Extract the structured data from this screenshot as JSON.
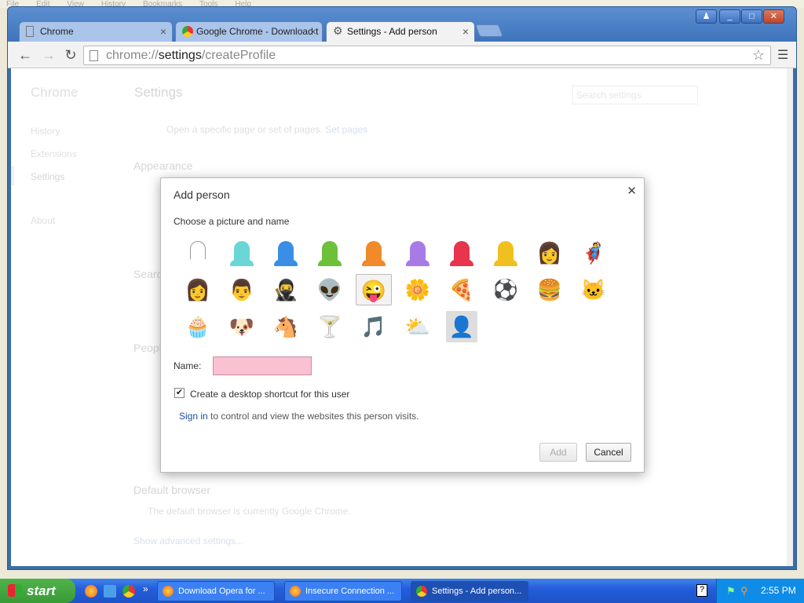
{
  "bg_menubar": [
    "File",
    "Edit",
    "View",
    "History",
    "Bookmarks",
    "Tools",
    "Help"
  ],
  "tabs": [
    {
      "label": "Chrome"
    },
    {
      "label": "Google Chrome - Download t"
    },
    {
      "label": "Settings - Add person"
    }
  ],
  "omnibox": {
    "scheme": "chrome://",
    "host": "settings",
    "path": "/createProfile"
  },
  "page": {
    "sidebar_title": "Chrome",
    "sidebar_items": [
      "History",
      "Extensions",
      "Settings",
      "About"
    ],
    "title": "Settings",
    "search_placeholder": "Search settings",
    "open_specific": "Open a specific page or set of pages.",
    "set_pages": "Set pages",
    "appearance": "Appearance",
    "search": "Searc",
    "people": "People",
    "default_browser": "Default browser",
    "default_browser_text": "The default browser is currently Google Chrome.",
    "show_advanced": "Show advanced settings..."
  },
  "dialog": {
    "title": "Add person",
    "subtitle": "Choose a picture and name",
    "name_label": "Name:",
    "name_value": "",
    "shortcut_label": "Create a desktop shortcut for this user",
    "shortcut_checked": true,
    "signin_link": "Sign in",
    "signin_rest": " to control and view the websites this person visits.",
    "add_label": "Add",
    "cancel_label": "Cancel",
    "avatars": [
      {
        "name": "white-head",
        "color": "#ffffff"
      },
      {
        "name": "cyan-head",
        "color": "#6ad6d6"
      },
      {
        "name": "blue-head",
        "color": "#3a8ee6"
      },
      {
        "name": "green-head",
        "color": "#6cc03a"
      },
      {
        "name": "orange-head",
        "color": "#f08a2a"
      },
      {
        "name": "purple-head",
        "color": "#a87ae6"
      },
      {
        "name": "red-head",
        "color": "#e8344c"
      },
      {
        "name": "yellow-head",
        "color": "#f0c020"
      },
      {
        "name": "businesswoman",
        "glyph": "👩"
      },
      {
        "name": "ninja-hero",
        "glyph": "🦸"
      },
      {
        "name": "woman-sunglasses",
        "glyph": "👩"
      },
      {
        "name": "man",
        "glyph": "👨"
      },
      {
        "name": "ninja",
        "glyph": "🥷"
      },
      {
        "name": "alien",
        "glyph": "👽"
      },
      {
        "name": "smiley",
        "glyph": "😜"
      },
      {
        "name": "flower",
        "glyph": "🌼"
      },
      {
        "name": "pizza",
        "glyph": "🍕"
      },
      {
        "name": "soccer-ball",
        "glyph": "⚽"
      },
      {
        "name": "burger",
        "glyph": "🍔"
      },
      {
        "name": "cat",
        "glyph": "🐱"
      },
      {
        "name": "cupcake",
        "glyph": "🧁"
      },
      {
        "name": "dog",
        "glyph": "🐶"
      },
      {
        "name": "horse",
        "glyph": "🐴"
      },
      {
        "name": "cocktail",
        "glyph": "🍸"
      },
      {
        "name": "music-note",
        "glyph": "🎵"
      },
      {
        "name": "sun-cloud",
        "glyph": "⛅"
      },
      {
        "name": "generic-person",
        "glyph": "👤"
      }
    ]
  },
  "taskbar": {
    "start": "start",
    "tasks": [
      "Download Opera for ...",
      "Insecure Connection ...",
      "Settings - Add person..."
    ],
    "clock": "2:55 PM"
  }
}
